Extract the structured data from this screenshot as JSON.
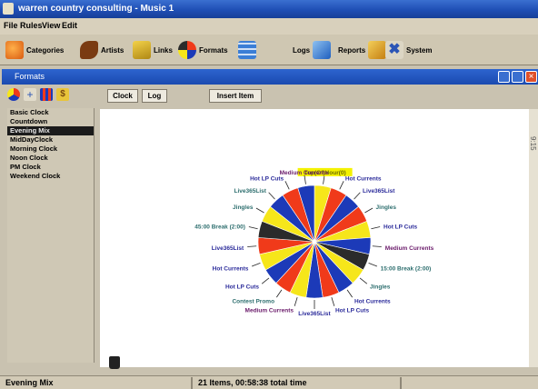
{
  "app": {
    "title": "warren country consulting - Music 1"
  },
  "menu": [
    "File",
    "Rules",
    "View",
    "Edit"
  ],
  "toolbar": [
    {
      "label": "Categories",
      "icon": "categories-icon",
      "color": "#e06a1a"
    },
    {
      "label": "Artists",
      "icon": "artist-icon",
      "color": "#7a3b12"
    },
    {
      "label": "Links",
      "icon": "links-icon",
      "color": "#e7b91a"
    },
    {
      "label": "Formats",
      "icon": "formats-icon",
      "color": "#2a45b4"
    },
    {
      "label": "Logs",
      "icon": "logs-icon",
      "color": "#3b7ed6"
    },
    {
      "label": "Reports",
      "icon": "reports-icon",
      "color": "#e6a21c"
    },
    {
      "label": "System",
      "icon": "tools-icon",
      "color": "#2b55b6"
    }
  ],
  "formats_window": {
    "title": "Formats",
    "tabs": [
      "Clock",
      "Log"
    ],
    "insert_button": "Insert Item",
    "clock_list": [
      "Basic Clock",
      "Countdown",
      "Evening Mix",
      "MidDayClock",
      "Morning Clock",
      "Noon Clock",
      "PM Clock",
      "Weekend Clock"
    ],
    "selected_index": 2,
    "side_text": "9:15"
  },
  "clock_labels": [
    {
      "text": "Top(Of)Hour(0)",
      "color": "#6c6c00",
      "highlight": "#f4f200"
    },
    {
      "text": "Hot Currents",
      "color": "#2a2a9a"
    },
    {
      "text": "Live365List",
      "color": "#2a2a9a"
    },
    {
      "text": "Jingles",
      "color": "#2d6e6e"
    },
    {
      "text": "Hot LP Cuts",
      "color": "#2a2a9a"
    },
    {
      "text": "Medium Currents",
      "color": "#6a1a6a"
    },
    {
      "text": "15:00 Break (2:00)",
      "color": "#2d6e6e"
    },
    {
      "text": "Jingles",
      "color": "#2d6e6e"
    },
    {
      "text": "Hot Currents",
      "color": "#2a2a9a"
    },
    {
      "text": "Hot LP Cuts",
      "color": "#2a2a9a"
    },
    {
      "text": "Live365List",
      "color": "#2a2a9a"
    },
    {
      "text": "Medium Currents",
      "color": "#6a1a6a"
    },
    {
      "text": "Contest Promo",
      "color": "#2d6e6e"
    },
    {
      "text": "Hot LP Cuts",
      "color": "#2a2a9a"
    },
    {
      "text": "Hot Currents",
      "color": "#2a2a9a"
    },
    {
      "text": "Live365List",
      "color": "#2a2a9a"
    },
    {
      "text": "45:00 Break (2:00)",
      "color": "#2d6e6e"
    },
    {
      "text": "Jingles",
      "color": "#2d6e6e"
    },
    {
      "text": "Live365List",
      "color": "#2d6e6e"
    },
    {
      "text": "Hot LP Cuts",
      "color": "#2a2a9a"
    },
    {
      "text": "Medium Currents",
      "color": "#6a1a6a"
    }
  ],
  "slice_colors": [
    "#f6e61a",
    "#f03a1a",
    "#1c3ab8",
    "#f03a1a",
    "#f6e61a",
    "#1c3ab8",
    "#2b2b2b",
    "#f6e61a",
    "#1c3ab8",
    "#f03a1a",
    "#1c3ab8",
    "#f6e61a",
    "#f03a1a",
    "#1c3ab8",
    "#f6e61a",
    "#f03a1a",
    "#2b2b2b",
    "#f6e61a",
    "#1c3ab8",
    "#f03a1a",
    "#1c3ab8"
  ],
  "status": {
    "clock": "Evening Mix",
    "summary": "21 Items,  00:58:38 total time"
  }
}
